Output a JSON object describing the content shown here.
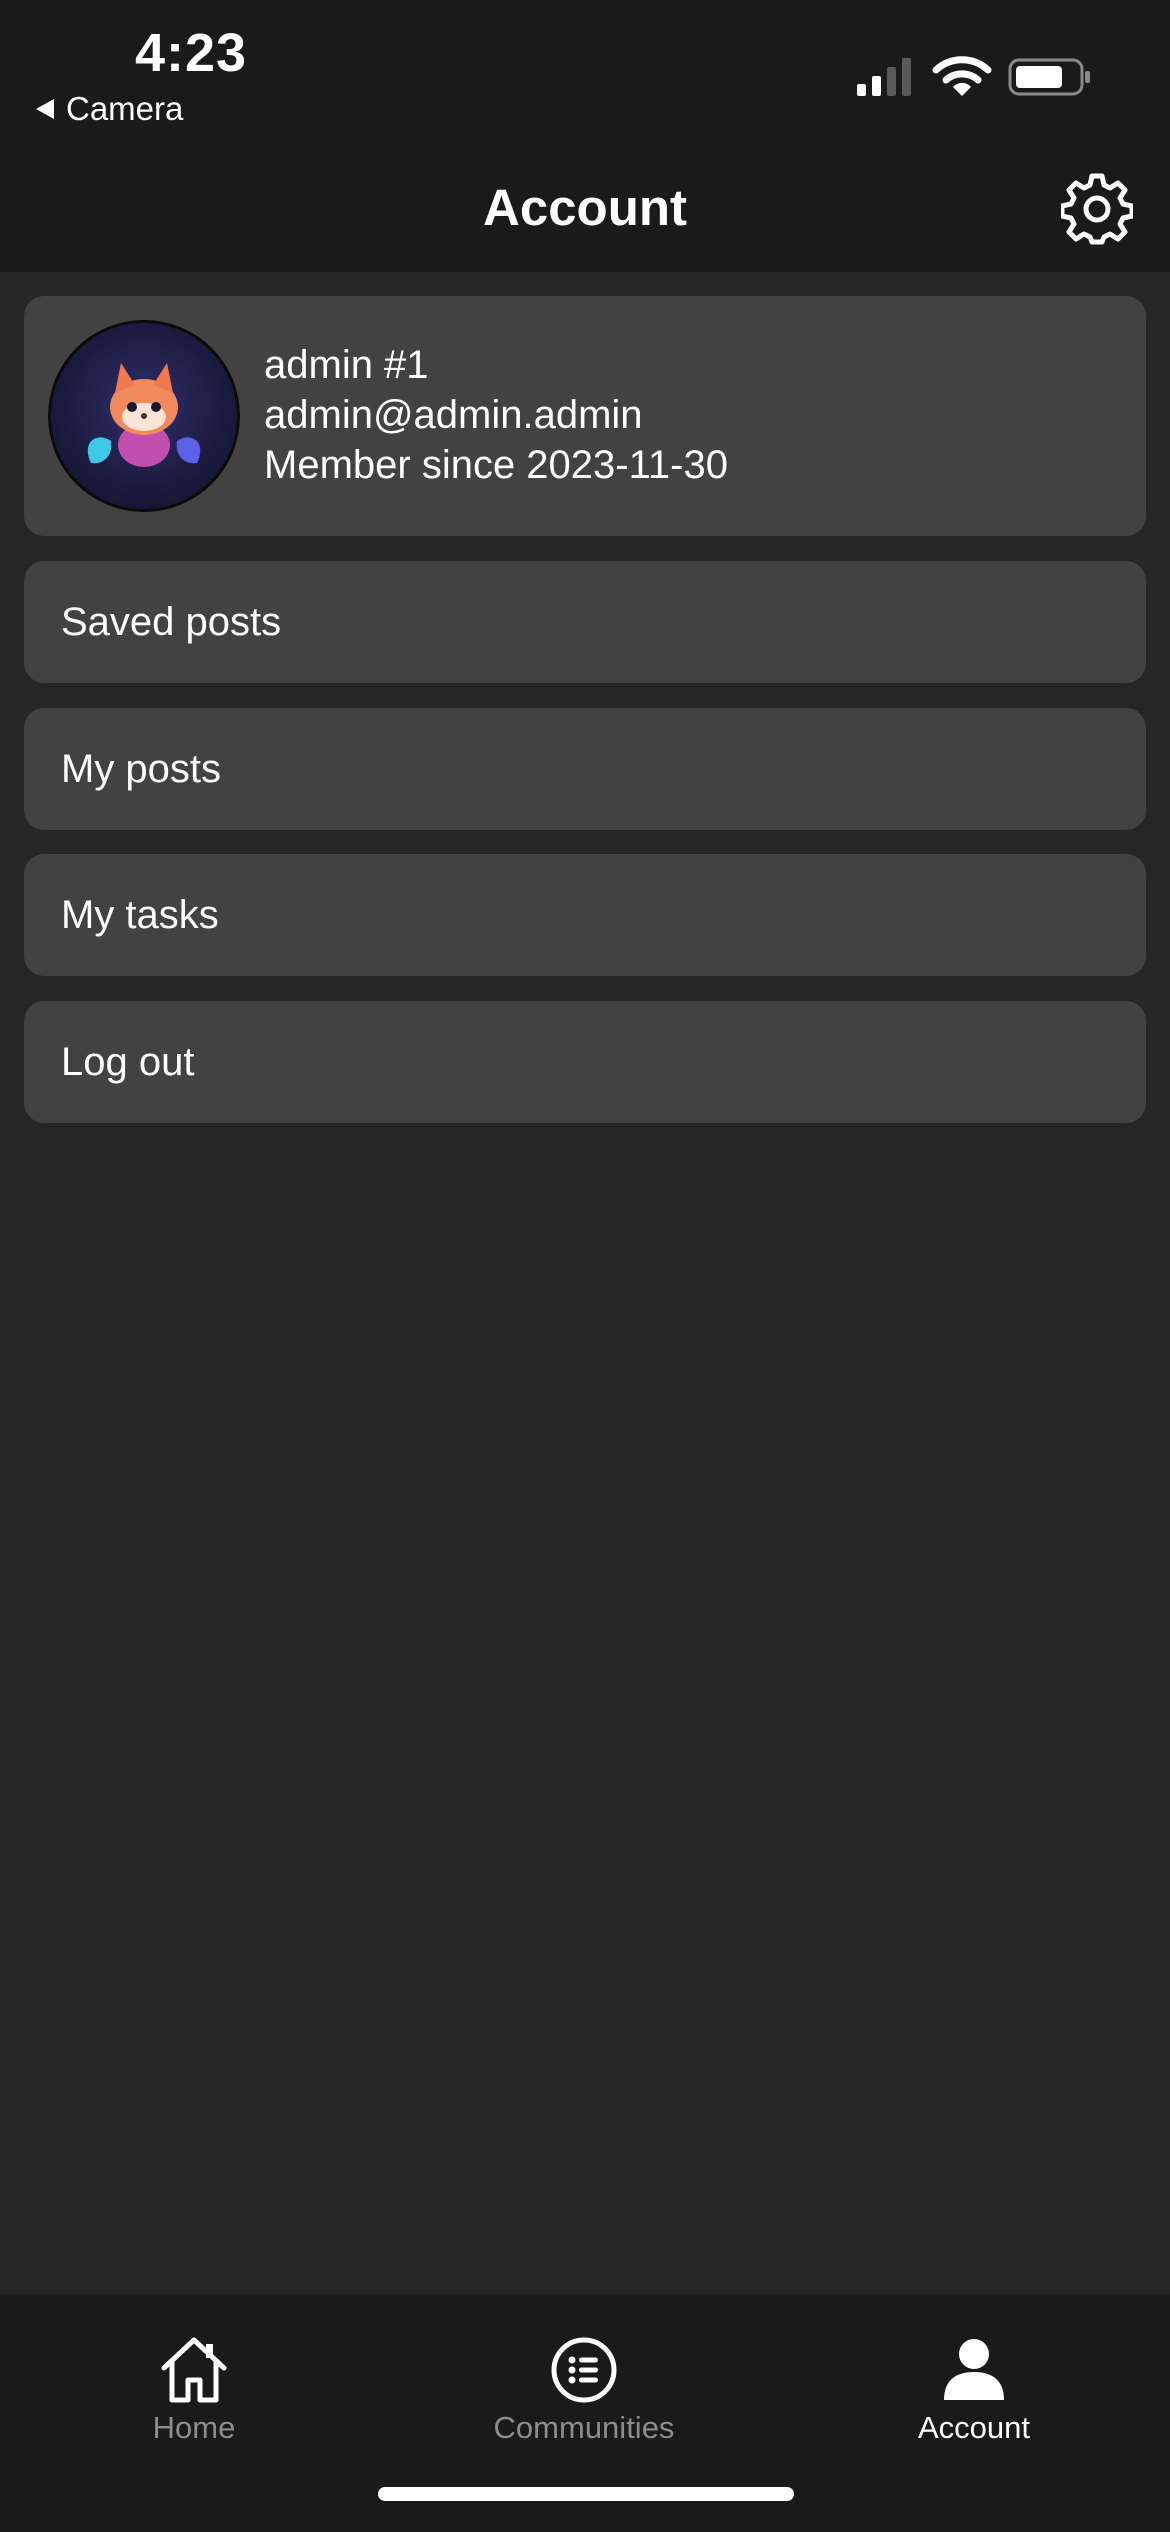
{
  "status_bar": {
    "time": "4:23",
    "back_app": "Camera",
    "signal_icon": "cellular-signal-icon",
    "wifi_icon": "wifi-icon",
    "battery_icon": "battery-icon"
  },
  "header": {
    "title": "Account",
    "settings_icon": "gear-icon"
  },
  "profile": {
    "name": "admin #1",
    "email": "admin@admin.admin",
    "member_since": "Member since 2023-11-30",
    "avatar_icon": "fox-avatar-icon"
  },
  "menu": {
    "saved_posts": "Saved posts",
    "my_posts": "My posts",
    "my_tasks": "My tasks",
    "log_out": "Log out"
  },
  "tabs": [
    {
      "label": "Home",
      "icon": "home-icon",
      "active": false
    },
    {
      "label": "Communities",
      "icon": "list-icon",
      "active": false
    },
    {
      "label": "Account",
      "icon": "person-icon",
      "active": true
    }
  ],
  "colors": {
    "background": "#262626",
    "bar_background": "#1a1a1a",
    "card": "#424242",
    "inactive_tab": "#8c8c8c",
    "active_tab": "#ffffff"
  }
}
